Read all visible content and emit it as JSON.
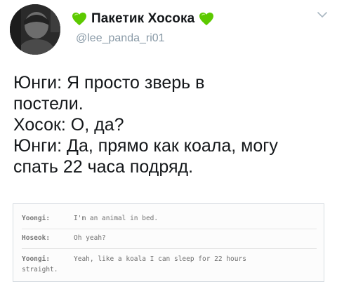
{
  "tweet": {
    "display_name": "Пакетик Хосока",
    "handle": "@lee_panda_ri01",
    "heart_color": "#5cc900",
    "text_lines": [
      "Юнги: Я просто зверь в",
      "постели.",
      "Хосок: О, да?",
      "Юнги: Да, прямо как коала, могу",
      "спать 22 часа подряд."
    ]
  },
  "chat": {
    "rows": [
      {
        "speaker": "Yoongi:",
        "message": "I'm an animal in bed."
      },
      {
        "speaker": "Hoseok:",
        "message": "Oh yeah?"
      },
      {
        "speaker": "Yoongi:",
        "message": "Yeah, like a koala I can sleep for 22 hours"
      }
    ],
    "wrap": "straight."
  },
  "icons": {
    "avatar": "profile-photo",
    "heart": "green-heart-emoji",
    "chevron": "chevron-down-icon"
  }
}
